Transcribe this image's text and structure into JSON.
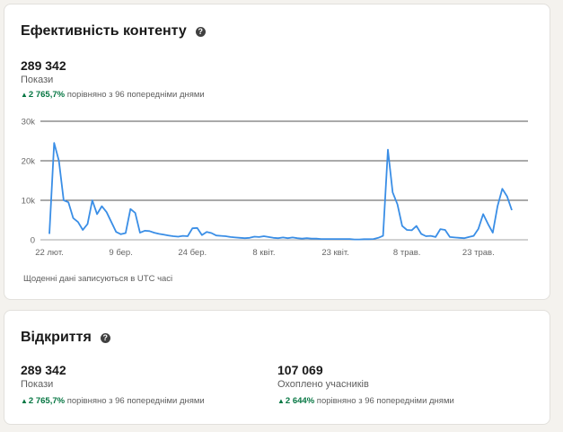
{
  "content_card": {
    "title": "Ефективність контенту",
    "help_glyph": "?",
    "metric_value": "289 342",
    "metric_label": "Покази",
    "change_arrow": "▲",
    "change_pct": "2 765,7%",
    "change_text": "порівняно з 96 попередніми днями",
    "footnote": "Щоденні дані записуються в UTC часі"
  },
  "openings_card": {
    "title": "Відкриття",
    "help_glyph": "?",
    "left": {
      "value": "289 342",
      "label": "Покази",
      "change_arrow": "▲",
      "change_pct": "2 765,7%",
      "change_text": "порівняно з 96 попередніми днями"
    },
    "right": {
      "value": "107 069",
      "label": "Охоплено учасників",
      "change_arrow": "▲",
      "change_pct": "2 644%",
      "change_text": "порівняно з 96 попередніми днями"
    }
  },
  "colors": {
    "line": "#3a8ee6",
    "positive": "#057642",
    "gridline": "#555555"
  },
  "chart_data": {
    "type": "line",
    "title": "",
    "xlabel": "",
    "ylabel": "",
    "ylim": [
      0,
      30000
    ],
    "y_ticks": [
      "0",
      "10k",
      "20k",
      "30k"
    ],
    "x_tick_labels": [
      "22 лют.",
      "9 бер.",
      "24 бер.",
      "8 квіт.",
      "23 квіт.",
      "8 трав.",
      "23 трав."
    ],
    "x_tick_index": [
      0,
      15,
      30,
      45,
      60,
      75,
      90
    ],
    "grid": true,
    "series": [
      {
        "name": "",
        "values": [
          1500,
          24500,
          20000,
          10000,
          9500,
          5500,
          4500,
          2500,
          4000,
          10000,
          6500,
          8500,
          7000,
          4500,
          2000,
          1400,
          1700,
          7800,
          6800,
          1800,
          2300,
          2200,
          1800,
          1500,
          1300,
          1100,
          900,
          800,
          1000,
          900,
          2900,
          3000,
          1200,
          2000,
          1700,
          1100,
          1000,
          900,
          700,
          600,
          500,
          400,
          500,
          800,
          700,
          900,
          700,
          500,
          400,
          600,
          400,
          600,
          400,
          300,
          400,
          300,
          300,
          200,
          200,
          200,
          200,
          200,
          200,
          200,
          100,
          100,
          150,
          150,
          200,
          500,
          1000,
          22800,
          12000,
          9000,
          3500,
          2500,
          2400,
          3500,
          1500,
          900,
          1000,
          700,
          2700,
          2500,
          700,
          600,
          500,
          400,
          700,
          1000,
          2800,
          6500,
          4000,
          1800,
          8500,
          12900,
          11000,
          7500
        ]
      }
    ]
  }
}
